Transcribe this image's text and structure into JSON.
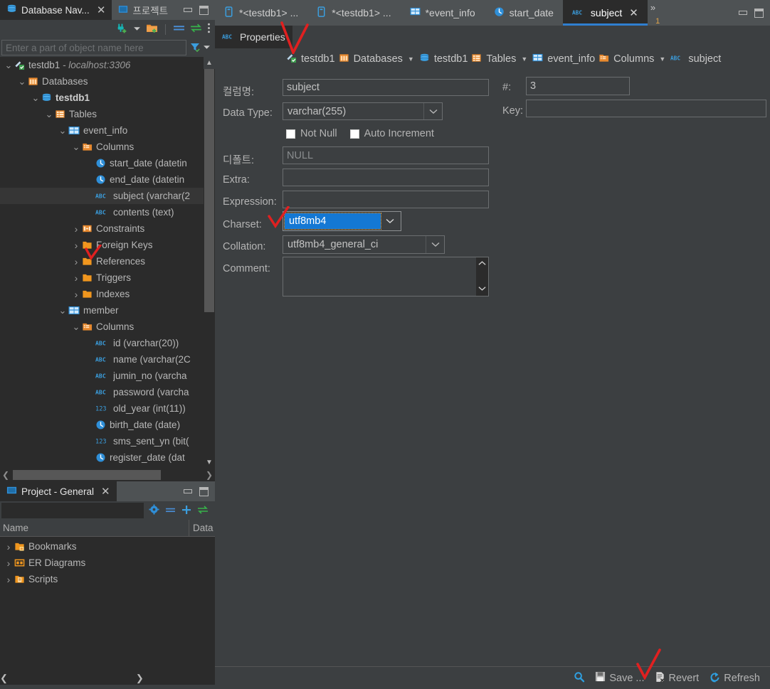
{
  "window": {
    "minimize_label": "minimize",
    "maximize_label": "maximize"
  },
  "left_panel": {
    "tabs": [
      {
        "label": "Database Nav...",
        "icon": "database-icon",
        "active": true,
        "closable": true
      },
      {
        "label": "프로젝트",
        "icon": "project-icon",
        "active": false,
        "closable": false
      }
    ],
    "toolbar": [
      {
        "name": "new-connection-icon",
        "title": "New Connection"
      },
      {
        "name": "chevron-down-icon",
        "title": "More"
      },
      {
        "name": "open-folder-icon",
        "title": "Open"
      },
      {
        "name": "collapse-all-icon",
        "title": "Collapse All"
      },
      {
        "name": "sync-icon",
        "title": "Sync"
      },
      {
        "name": "more-vertical-icon",
        "title": "Options"
      }
    ],
    "filter": {
      "placeholder": "Enter a part of object name here",
      "value": "",
      "filter_icon": "funnel-icon",
      "dropdown_icon": "chevron-down-icon"
    },
    "tree": [
      {
        "indent": 0,
        "twist": "expanded",
        "icon": "connection-icon",
        "label": "testdb1",
        "suffix": " - localhost:3306",
        "suffix_style": "italic",
        "bold": false
      },
      {
        "indent": 1,
        "twist": "expanded",
        "icon": "databases-icon",
        "label": "Databases",
        "suffix": "",
        "bold": false
      },
      {
        "indent": 2,
        "twist": "expanded",
        "icon": "schema-icon",
        "label": "testdb1",
        "suffix": "",
        "bold": true
      },
      {
        "indent": 3,
        "twist": "expanded",
        "icon": "tables-icon",
        "label": "Tables",
        "suffix": "",
        "bold": false
      },
      {
        "indent": 4,
        "twist": "expanded",
        "icon": "table-icon",
        "label": "event_info",
        "suffix": "",
        "bold": false
      },
      {
        "indent": 5,
        "twist": "expanded",
        "icon": "columns-icon",
        "label": "Columns",
        "suffix": "",
        "bold": false
      },
      {
        "indent": 6,
        "twist": "none",
        "icon": "clock-icon",
        "label": "start_date (datetin",
        "suffix": "",
        "bold": false
      },
      {
        "indent": 6,
        "twist": "none",
        "icon": "clock-icon",
        "label": "end_date (datetin",
        "suffix": "",
        "bold": false
      },
      {
        "indent": 6,
        "twist": "none",
        "icon": "abc-icon",
        "label": "subject (varchar(2",
        "suffix": "",
        "bold": false,
        "selected": true
      },
      {
        "indent": 6,
        "twist": "none",
        "icon": "abc-icon",
        "label": "contents (text)",
        "suffix": "",
        "bold": false
      },
      {
        "indent": 5,
        "twist": "collapsed",
        "icon": "constraints-icon",
        "label": "Constraints",
        "suffix": "",
        "bold": false
      },
      {
        "indent": 5,
        "twist": "collapsed",
        "icon": "folder-icon",
        "label": "Foreign Keys",
        "suffix": "",
        "bold": false
      },
      {
        "indent": 5,
        "twist": "collapsed",
        "icon": "folder-icon",
        "label": "References",
        "suffix": "",
        "bold": false
      },
      {
        "indent": 5,
        "twist": "collapsed",
        "icon": "folder-icon",
        "label": "Triggers",
        "suffix": "",
        "bold": false
      },
      {
        "indent": 5,
        "twist": "collapsed",
        "icon": "folder-icon",
        "label": "Indexes",
        "suffix": "",
        "bold": false
      },
      {
        "indent": 4,
        "twist": "expanded",
        "icon": "table-icon",
        "label": "member",
        "suffix": "",
        "bold": false
      },
      {
        "indent": 5,
        "twist": "expanded",
        "icon": "columns-icon",
        "label": "Columns",
        "suffix": "",
        "bold": false
      },
      {
        "indent": 6,
        "twist": "none",
        "icon": "abc-icon",
        "label": "id (varchar(20))",
        "suffix": "",
        "bold": false
      },
      {
        "indent": 6,
        "twist": "none",
        "icon": "abc-icon",
        "label": "name (varchar(2C",
        "suffix": "",
        "bold": false
      },
      {
        "indent": 6,
        "twist": "none",
        "icon": "abc-icon",
        "label": "jumin_no (varcha",
        "suffix": "",
        "bold": false
      },
      {
        "indent": 6,
        "twist": "none",
        "icon": "abc-icon",
        "label": "password (varcha",
        "suffix": "",
        "bold": false
      },
      {
        "indent": 6,
        "twist": "none",
        "icon": "123-icon",
        "label": "old_year (int(11))",
        "suffix": "",
        "bold": false
      },
      {
        "indent": 6,
        "twist": "none",
        "icon": "clock-icon",
        "label": "birth_date (date)",
        "suffix": "",
        "bold": false
      },
      {
        "indent": 6,
        "twist": "none",
        "icon": "123-icon",
        "label": "sms_sent_yn (bit(",
        "suffix": "",
        "bold": false
      },
      {
        "indent": 6,
        "twist": "none",
        "icon": "clock-icon",
        "label": "register_date (dat",
        "suffix": "",
        "bold": false
      }
    ]
  },
  "project_panel": {
    "tab": {
      "label": "Project - General",
      "icon": "project-icon",
      "closable": true
    },
    "toolbar": [
      {
        "name": "gear-icon",
        "title": "Settings"
      },
      {
        "name": "collapse-all-icon",
        "title": "Collapse All"
      },
      {
        "name": "add-icon",
        "title": "Add"
      },
      {
        "name": "sync-icon",
        "title": "Sync"
      }
    ],
    "columns": [
      "Name",
      "Data"
    ],
    "rows": [
      {
        "twist": "collapsed",
        "icon": "bookmarks-folder-icon",
        "label": "Bookmarks"
      },
      {
        "twist": "collapsed",
        "icon": "er-diagram-icon",
        "label": "ER Diagrams"
      },
      {
        "twist": "collapsed",
        "icon": "scripts-folder-icon",
        "label": "Scripts"
      }
    ]
  },
  "editor": {
    "tabs": [
      {
        "label": "*<testdb1> ...",
        "icon": "sql-editor-icon",
        "active": false,
        "closable": false
      },
      {
        "label": "*<testdb1> ...",
        "icon": "sql-editor-icon",
        "active": false,
        "closable": false
      },
      {
        "label": "*event_info",
        "icon": "table-icon",
        "active": false,
        "closable": false
      },
      {
        "label": "start_date",
        "icon": "clock-icon",
        "active": false,
        "closable": false
      },
      {
        "label": "subject",
        "icon": "abc-icon",
        "active": true,
        "closable": true
      }
    ],
    "overflow": {
      "symbol": "»",
      "count": "1"
    },
    "sub_tabs": [
      {
        "label": "Properties",
        "icon": "abc-icon",
        "active": true
      }
    ],
    "breadcrumb": [
      {
        "label": "testdb1",
        "icon": "connection-icon",
        "caret": false
      },
      {
        "label": "Databases",
        "icon": "databases-icon",
        "caret": true
      },
      {
        "label": "testdb1",
        "icon": "schema-icon",
        "caret": false
      },
      {
        "label": "Tables",
        "icon": "tables-icon",
        "caret": true
      },
      {
        "label": "event_info",
        "icon": "table-icon",
        "caret": false
      },
      {
        "label": "Columns",
        "icon": "columns-icon",
        "caret": true
      },
      {
        "label": "subject",
        "icon": "abc-icon",
        "caret": false
      }
    ]
  },
  "form": {
    "column_name": {
      "label": "컬럼명:",
      "value": "subject"
    },
    "data_type": {
      "label": "Data Type:",
      "value": "varchar(255)"
    },
    "not_null": {
      "label": "Not Null",
      "checked": false
    },
    "auto_increment": {
      "label": "Auto Increment",
      "checked": false
    },
    "default": {
      "label": "디폴트:",
      "value": "NULL"
    },
    "extra": {
      "label": "Extra:",
      "value": ""
    },
    "expression": {
      "label": "Expression:",
      "value": ""
    },
    "charset": {
      "label": "Charset:",
      "value": "utf8mb4",
      "focused": true
    },
    "collation": {
      "label": "Collation:",
      "value": "utf8mb4_general_ci"
    },
    "comment": {
      "label": "Comment:",
      "value": ""
    },
    "number": {
      "label": "#:",
      "value": "3"
    },
    "key": {
      "label": "Key:",
      "value": ""
    }
  },
  "statusbar": {
    "items": [
      {
        "name": "search-icon",
        "label": "",
        "icon": "search-icon"
      },
      {
        "name": "save-button",
        "label": "Save ...",
        "icon": "save-icon"
      },
      {
        "name": "revert-button",
        "label": "Revert",
        "icon": "revert-icon"
      },
      {
        "name": "refresh-button",
        "label": "Refresh",
        "icon": "refresh-icon"
      }
    ]
  },
  "annotations": {
    "color": "#e02020",
    "marks": [
      {
        "name": "checkmark-properties-tab"
      },
      {
        "name": "checkmark-subject-tree-row"
      },
      {
        "name": "checkmark-charset-field"
      },
      {
        "name": "checkmark-save-button"
      }
    ]
  }
}
